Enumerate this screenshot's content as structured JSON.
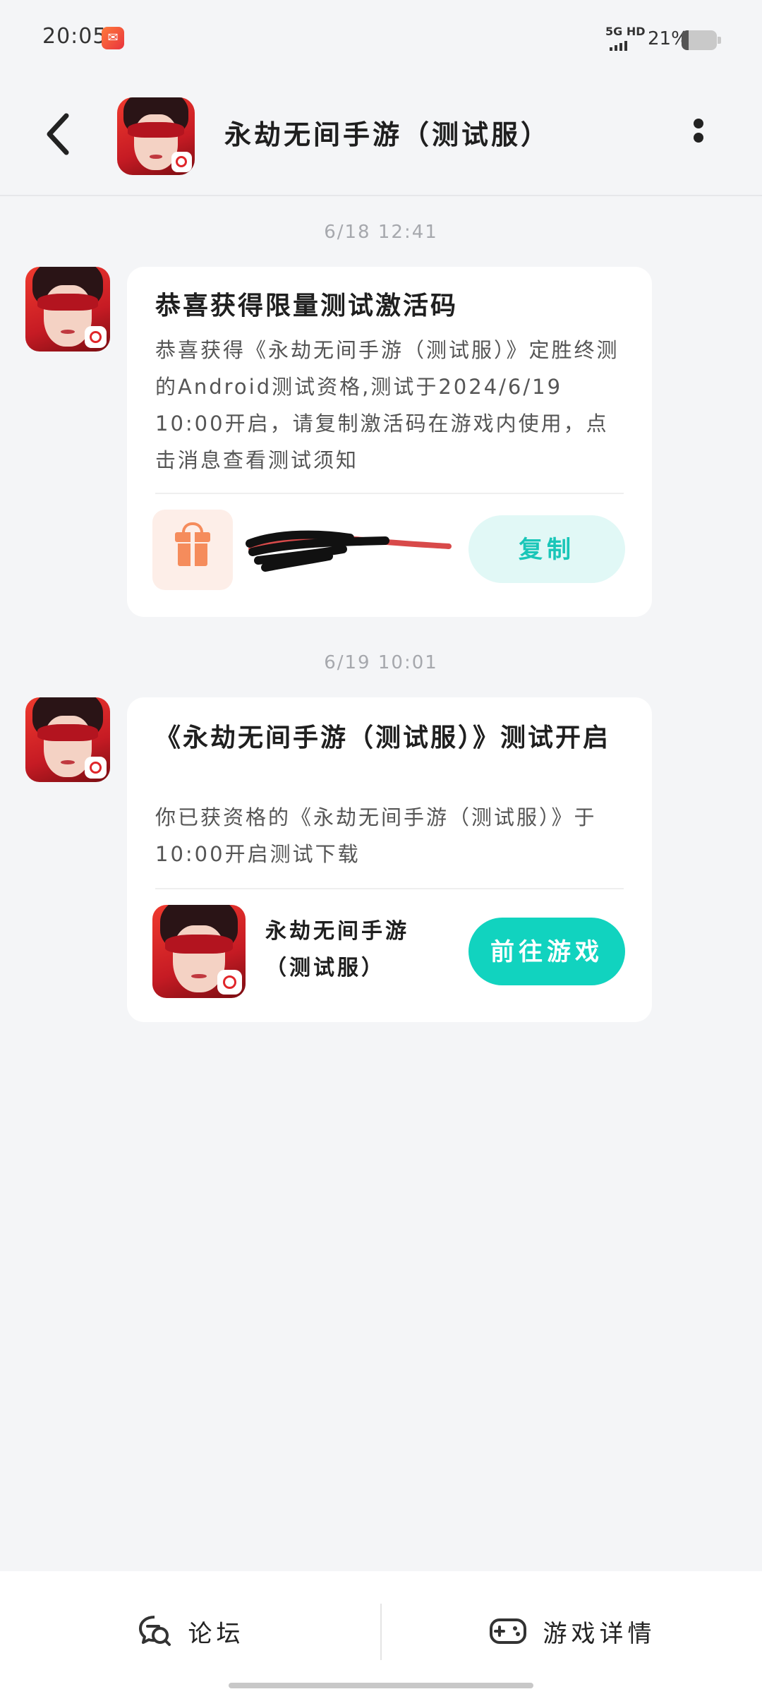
{
  "status_bar": {
    "time": "20:05",
    "network": "5G HD",
    "battery_percent": "21%",
    "battery_level": 0.21
  },
  "header": {
    "title": "永劫无间手游（测试服）"
  },
  "messages": [
    {
      "timestamp": "6/18 12:41",
      "title": "恭喜获得限量测试激活码",
      "body": "恭喜获得《永劫无间手游（测试服）》定胜终测的Android测试资格,测试于2024/6/19 10:00开启，请复制激活码在游戏内使用，点击消息查看测试须知",
      "action_label": "复制"
    },
    {
      "timestamp": "6/19 10:01",
      "title": "《永劫无间手游（测试服）》测试开启",
      "body": "你已获资格的《永劫无间手游（测试服）》于10:00开启测试下载",
      "game_name_line1": "永劫无间手游",
      "game_name_line2": "（测试服）",
      "action_label": "前往游戏"
    }
  ],
  "bottom_bar": {
    "forum_label": "论坛",
    "details_label": "游戏详情"
  },
  "colors": {
    "accent": "#11d3bf",
    "accent_light": "#e1f8f6",
    "gift": "#f58c5c",
    "background": "#f4f5f7"
  }
}
